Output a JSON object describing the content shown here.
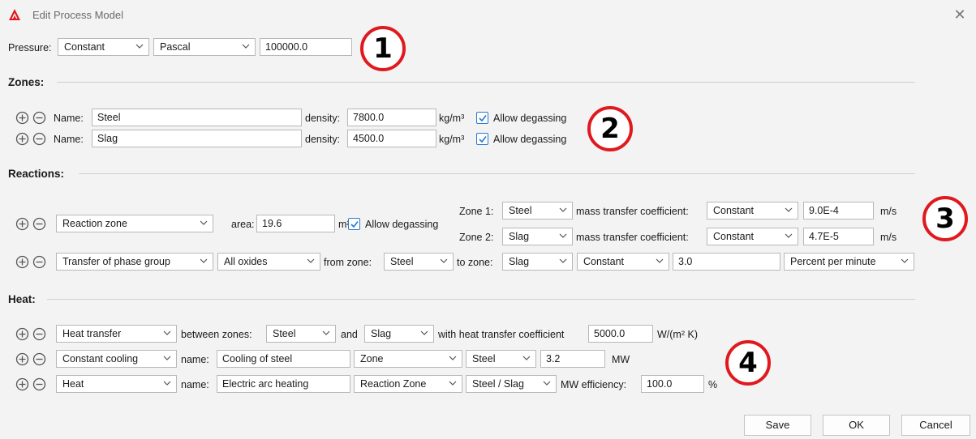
{
  "window": {
    "title": "Edit Process Model"
  },
  "pressure": {
    "label": "Pressure:",
    "mode": "Constant",
    "unit": "Pascal",
    "value": "100000.0"
  },
  "zones": {
    "heading": "Zones:",
    "name_label": "Name:",
    "density_label": "density:",
    "density_unit": "kg/m³",
    "degas_label": "Allow degassing",
    "rows": [
      {
        "name": "Steel",
        "density": "7800.0"
      },
      {
        "name": "Slag",
        "density": "4500.0"
      }
    ]
  },
  "reactions": {
    "heading": "Reactions:",
    "row1": {
      "type": "Reaction zone",
      "area_label": "area:",
      "area": "19.6",
      "area_unit": "m²",
      "degas_label": "Allow degassing",
      "zone1_label": "Zone 1:",
      "zone1": "Steel",
      "zone2_label": "Zone 2:",
      "zone2": "Slag",
      "mtc_label": "mass transfer coefficient:",
      "mtc1_mode": "Constant",
      "mtc1_value": "9.0E-4",
      "mtc2_mode": "Constant",
      "mtc2_value": "4.7E-5",
      "mtc_unit": "m/s"
    },
    "row2": {
      "type": "Transfer of phase group",
      "group": "All oxides",
      "from_label": "from zone:",
      "from": "Steel",
      "to_label": "to zone:",
      "to": "Slag",
      "mode": "Constant",
      "value": "3.0",
      "unit": "Percent per minute"
    }
  },
  "heat": {
    "heading": "Heat:",
    "row1": {
      "type": "Heat transfer",
      "between_label": "between zones:",
      "zone_a": "Steel",
      "and_label": "and",
      "zone_b": "Slag",
      "coef_label": "with heat transfer coefficient",
      "coef": "5000.0",
      "coef_unit": "W/(m² K)"
    },
    "row2": {
      "type": "Constant cooling",
      "name_label": "name:",
      "name": "Cooling of steel",
      "target": "Zone",
      "zone": "Steel",
      "value": "3.2",
      "unit": "MW"
    },
    "row3": {
      "type": "Heat",
      "name_label": "name:",
      "name": "Electric arc heating",
      "target": "Reaction Zone",
      "zone": "Steel / Slag",
      "unit_eff": "MW efficiency:",
      "efficiency": "100.0",
      "pct": "%"
    }
  },
  "badges": [
    "1",
    "2",
    "3",
    "4"
  ],
  "buttons": {
    "save": "Save",
    "ok": "OK",
    "cancel": "Cancel"
  },
  "colors": {
    "accent": "#2b79d0",
    "badge": "#e0191e",
    "logo": "#e0191e"
  },
  "icons": {
    "add": "plus-circle-icon",
    "remove": "minus-circle-icon",
    "chevron": "chevron-down-icon",
    "close": "close-icon"
  }
}
